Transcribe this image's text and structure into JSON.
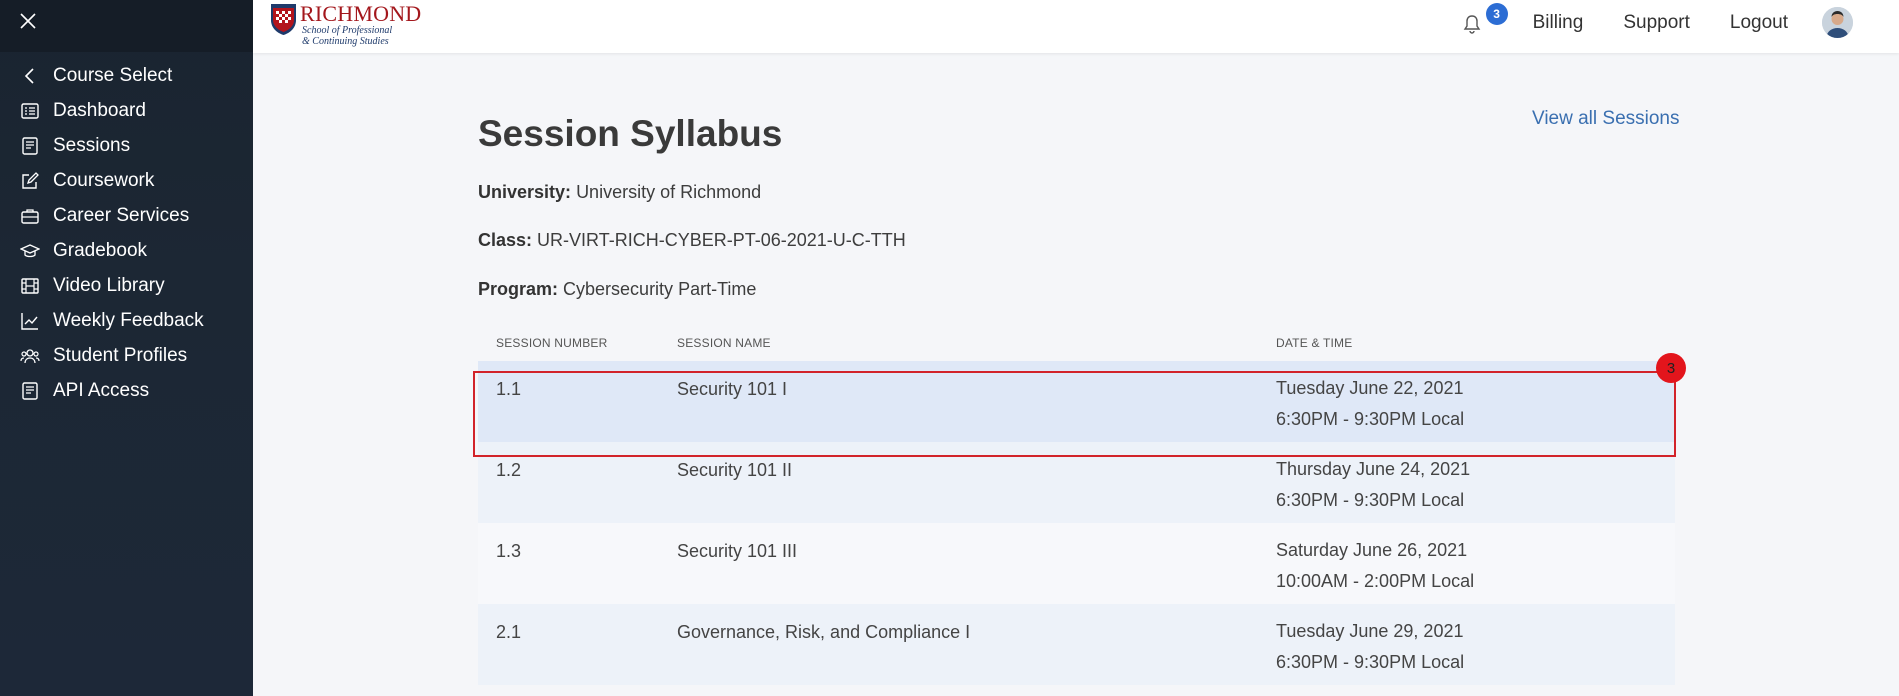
{
  "sidebar": {
    "items": [
      {
        "label": "Course Select",
        "icon": "chevron-left-icon"
      },
      {
        "label": "Dashboard",
        "icon": "dashboard-list-icon"
      },
      {
        "label": "Sessions",
        "icon": "book-icon"
      },
      {
        "label": "Coursework",
        "icon": "edit-icon"
      },
      {
        "label": "Career Services",
        "icon": "briefcase-icon"
      },
      {
        "label": "Gradebook",
        "icon": "graduation-cap-icon"
      },
      {
        "label": "Video Library",
        "icon": "film-icon"
      },
      {
        "label": "Weekly Feedback",
        "icon": "chart-line-icon"
      },
      {
        "label": "Student Profiles",
        "icon": "users-icon"
      },
      {
        "label": "API Access",
        "icon": "book-icon"
      }
    ]
  },
  "header": {
    "logo": {
      "main": "RICHMOND",
      "sub1": "School of Professional",
      "sub2": "& Continuing Studies"
    },
    "notification_count": "3",
    "links": [
      "Billing",
      "Support",
      "Logout"
    ]
  },
  "main": {
    "title": "Session Syllabus",
    "view_all": "View all Sessions",
    "university_label": "University:",
    "university": "University of Richmond",
    "class_label": "Class:",
    "class": "UR-VIRT-RICH-CYBER-PT-06-2021-U-C-TTH",
    "program_label": "Program:",
    "program": "Cybersecurity Part-Time",
    "table": {
      "headers": [
        "SESSION NUMBER",
        "SESSION NAME",
        "DATE & TIME"
      ],
      "rows": [
        {
          "number": "1.1",
          "name": "Security 101 I",
          "date": "Tuesday June 22, 2021",
          "time": "6:30PM - 9:30PM Local"
        },
        {
          "number": "1.2",
          "name": "Security 101 II",
          "date": "Thursday June 24, 2021",
          "time": "6:30PM - 9:30PM Local"
        },
        {
          "number": "1.3",
          "name": "Security 101 III",
          "date": "Saturday June 26, 2021",
          "time": "10:00AM - 2:00PM Local"
        },
        {
          "number": "2.1",
          "name": "Governance, Risk, and Compliance I",
          "date": "Tuesday June 29, 2021",
          "time": "6:30PM - 9:30PM Local"
        }
      ]
    },
    "highlight_badge": "3"
  },
  "colors": {
    "accent": "#2c6dd4",
    "link": "#3a6fb0",
    "highlight": "#d2232a",
    "sidebar": "#1c2734"
  }
}
